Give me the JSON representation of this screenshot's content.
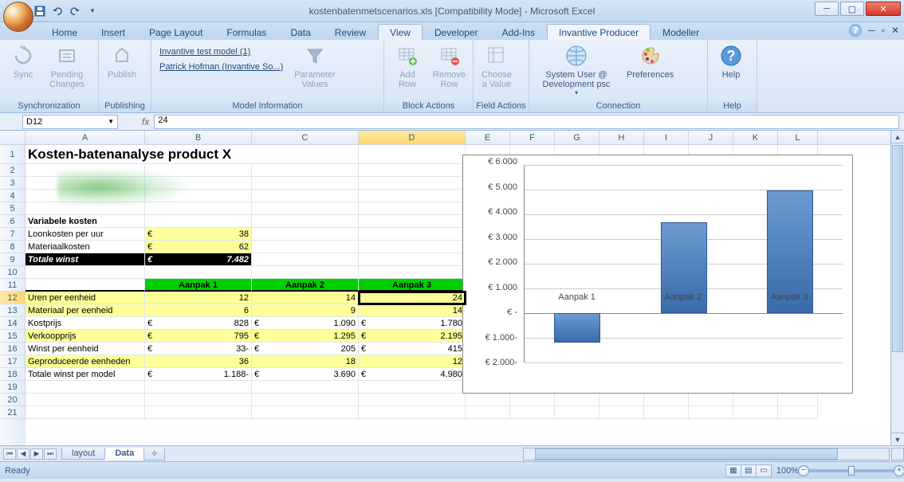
{
  "title": "kostenbatenmetscenarios.xls  [Compatibility Mode] - Microsoft Excel",
  "tabs": [
    "Home",
    "Insert",
    "Page Layout",
    "Formulas",
    "Data",
    "Review",
    "View",
    "Developer",
    "Add-Ins",
    "Invantive Producer",
    "Modeller"
  ],
  "active_tab": "Invantive Producer",
  "highlight_tab": "View",
  "ribbon": {
    "sync_group": "Synchronization",
    "sync": "Sync",
    "pending": "Pending\nChanges",
    "publishing": "Publishing",
    "publish": "Publish",
    "model_info": "Model Information",
    "model_name": "Invantive test model (1)",
    "user_name": "Patrick Hofman (Invantive So...)",
    "param": "Parameter\nValues",
    "block": "Block Actions",
    "addrow": "Add\nRow",
    "removerow": "Remove\nRow",
    "field": "Field Actions",
    "choose": "Choose\na Value",
    "connection": "Connection",
    "sysuser": "System User @\nDevelopment psc",
    "prefs": "Preferences",
    "help_group": "Help",
    "help": "Help"
  },
  "namebox": "D12",
  "formula": "24",
  "columns": [
    "A",
    "B",
    "C",
    "D",
    "E",
    "F",
    "G",
    "H",
    "I",
    "J",
    "K",
    "L"
  ],
  "active_col": "D",
  "active_row": 12,
  "sheet": {
    "title": "Kosten-batenanalyse product X",
    "var_kosten": "Variabele kosten",
    "rows": {
      "r7": {
        "label": "Loonkosten per uur",
        "cur": "€",
        "val": "38"
      },
      "r8": {
        "label": "Materiaalkosten",
        "cur": "€",
        "val": "62"
      },
      "r9": {
        "label": "Totale winst",
        "cur": "€",
        "val": "7.482"
      },
      "hdr": {
        "b": "Aanpak 1",
        "c": "Aanpak 2",
        "d": "Aanpak 3"
      },
      "r12": {
        "label": "Uren per eenheid",
        "b": "12",
        "c": "14",
        "d": "24"
      },
      "r13": {
        "label": "Materiaal per eenheid",
        "b": "6",
        "c": "9",
        "d": "14"
      },
      "r14": {
        "label": "Kostprijs",
        "cur": "€",
        "b": "828",
        "c": "1.090",
        "d": "1.780"
      },
      "r15": {
        "label": "Verkoopprijs",
        "cur": "€",
        "b": "795",
        "c": "1.295",
        "d": "2.195"
      },
      "r16": {
        "label": "Winst per eenheid",
        "cur": "€",
        "b": "33-",
        "c": "205",
        "d": "415"
      },
      "r17": {
        "label": "Geproduceerde eenheden",
        "b": "36",
        "c": "18",
        "d": "12"
      },
      "r18": {
        "label": "Totale winst per model",
        "cur": "€",
        "b": "1.188-",
        "c": "3.690",
        "d": "4.980"
      }
    }
  },
  "chart_data": {
    "type": "bar",
    "categories": [
      "Aanpak 1",
      "Aanpak 2",
      "Aanpak 3"
    ],
    "values": [
      -1188,
      3690,
      4980
    ],
    "ylim": [
      -2000,
      6000
    ],
    "ytick_labels": [
      "€ 2.000-",
      "€ 1.000-",
      "€ -",
      "€ 1.000",
      "€ 2.000",
      "€ 3.000",
      "€ 4.000",
      "€ 5.000",
      "€ 6.000"
    ],
    "ytick_values": [
      -2000,
      -1000,
      0,
      1000,
      2000,
      3000,
      4000,
      5000,
      6000
    ]
  },
  "sheets": {
    "inactive": "layout",
    "active": "Data"
  },
  "status": {
    "ready": "Ready",
    "zoom": "100%"
  }
}
